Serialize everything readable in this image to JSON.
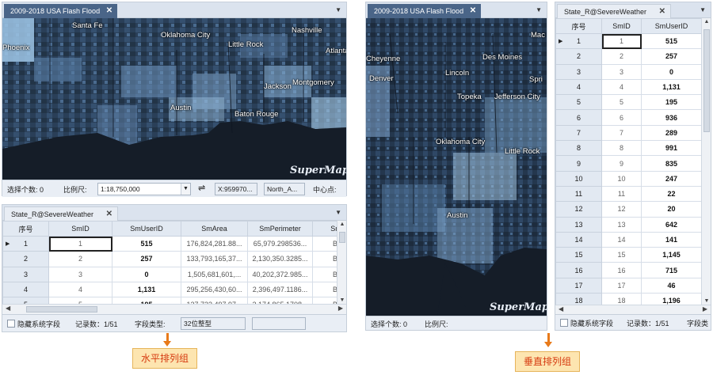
{
  "horizontal": {
    "map_tab": "2009-2018 USA Flash Flood",
    "map_cities": [
      "Santa Fe",
      "Phoenix",
      "Oklahoma City",
      "Little Rock",
      "Nashville",
      "Atlanta",
      "Jackson",
      "Montgomery",
      "Austin",
      "Baton Rouge"
    ],
    "logo": "SuperMap",
    "status": {
      "select_count": "选择个数: 0",
      "scale_label": "比例尺:",
      "scale_value": "1:18,750,000",
      "swap_icon": "⇌",
      "x_coord": "X:959970...",
      "projection": "North_A...",
      "center_label": "中心点:"
    },
    "table_tab": "State_R@SevereWeather",
    "columns": [
      "序号",
      "SmID",
      "SmUserID",
      "SmArea",
      "SmPerimeter",
      "Sm"
    ],
    "rows": [
      [
        "1",
        "1",
        "515",
        "176,824,281.88...",
        "65,979.298536...",
        "Bi"
      ],
      [
        "2",
        "2",
        "257",
        "133,793,165,37...",
        "2,130,350.3285...",
        "Bi"
      ],
      [
        "3",
        "3",
        "0",
        "1,505,681,601,...",
        "40,202,372.985...",
        "Bi"
      ],
      [
        "4",
        "4",
        "1,131",
        "295,256,430,60...",
        "2,396,497.1186...",
        "Bi"
      ],
      [
        "5",
        "5",
        "195",
        "137,733,497,97...",
        "2,174,865.1708...",
        "Bi"
      ]
    ],
    "footer": {
      "hide_label": "隐藏系统字段",
      "records": "记录数：1/51",
      "field_type_label": "字段类型:",
      "field_type_value": "32位整型"
    },
    "callout": "水平排列组"
  },
  "vertical": {
    "map_tab": "2009-2018 USA Flash Flood",
    "map_cities": [
      "Mac",
      "Cheyenne",
      "Des Moines",
      "Denver",
      "Lincoln",
      "Spri",
      "Topeka",
      "Jefferson City",
      "Oklahoma City",
      "Little Rock",
      "Austin"
    ],
    "logo": "SuperMap",
    "status": {
      "select_count": "选择个数: 0",
      "scale_label": "比例尺:"
    },
    "table_tab": "State_R@SevereWeather",
    "columns": [
      "序号",
      "SmID",
      "SmUserID"
    ],
    "rows": [
      [
        "1",
        "1",
        "515"
      ],
      [
        "2",
        "2",
        "257"
      ],
      [
        "3",
        "3",
        "0"
      ],
      [
        "4",
        "4",
        "1,131"
      ],
      [
        "5",
        "5",
        "195"
      ],
      [
        "6",
        "6",
        "936"
      ],
      [
        "7",
        "7",
        "289"
      ],
      [
        "8",
        "8",
        "991"
      ],
      [
        "9",
        "9",
        "835"
      ],
      [
        "10",
        "10",
        "247"
      ],
      [
        "11",
        "11",
        "22"
      ],
      [
        "12",
        "12",
        "20"
      ],
      [
        "13",
        "13",
        "642"
      ],
      [
        "14",
        "14",
        "141"
      ],
      [
        "15",
        "15",
        "1,145"
      ],
      [
        "16",
        "16",
        "715"
      ],
      [
        "17",
        "17",
        "46"
      ],
      [
        "18",
        "18",
        "1,196"
      ]
    ],
    "footer": {
      "hide_label": "隐藏系统字段",
      "records": "记录数：1/51",
      "field_type_label": "字段类"
    },
    "callout": "垂直排列组"
  },
  "colors": {
    "tab_active": "#4a6588",
    "callout_fill": "#fde5b0",
    "callout_text": "#d63a10",
    "arrow": "#e87a1a"
  }
}
